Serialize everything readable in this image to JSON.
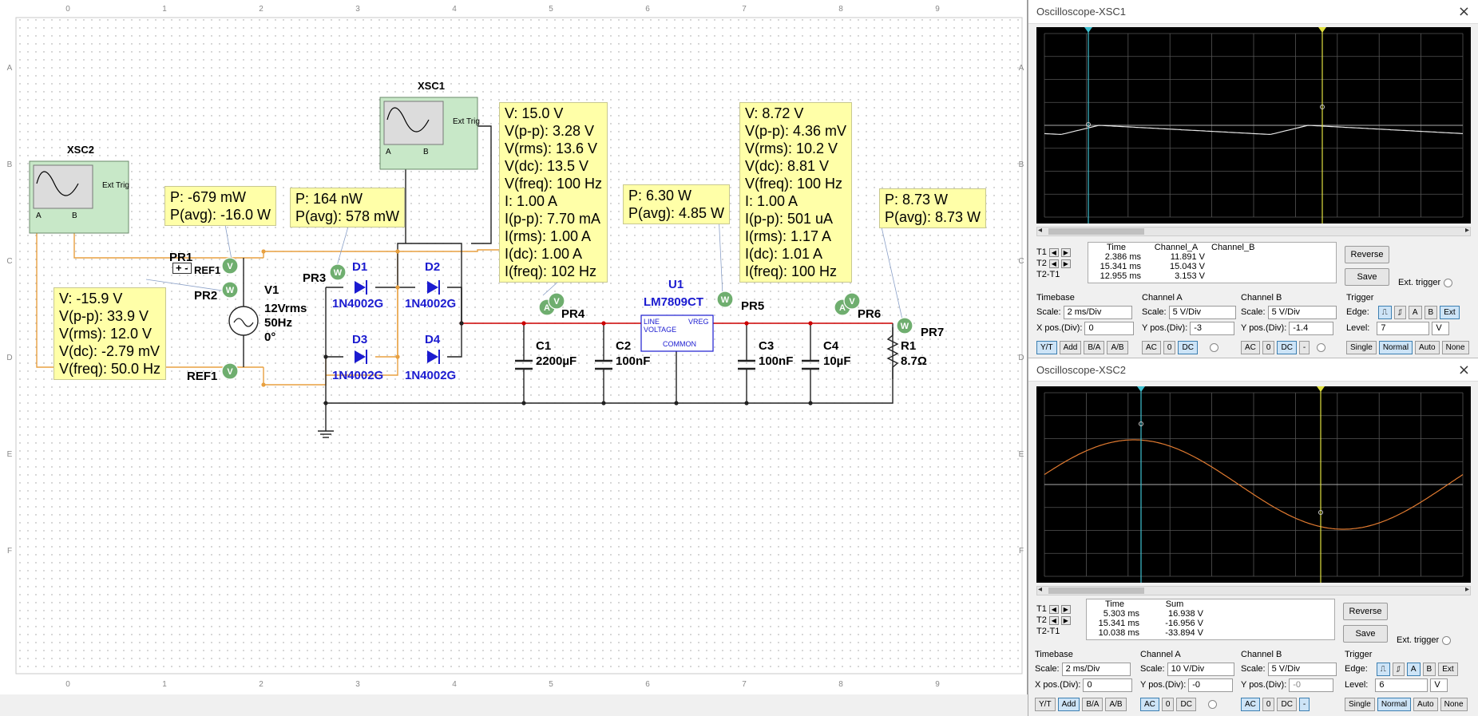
{
  "ruler": {
    "cols": [
      "0",
      "1",
      "2",
      "3",
      "4",
      "5",
      "6",
      "7",
      "8",
      "9"
    ],
    "rows": [
      "A",
      "B",
      "C",
      "D",
      "E",
      "F"
    ]
  },
  "instruments": {
    "xsc1": {
      "name": "XSC1",
      "ext_trig": "Ext Trig",
      "a": "A",
      "b": "B"
    },
    "xsc2": {
      "name": "XSC2",
      "ext_trig": "Ext Trig",
      "a": "A",
      "b": "B"
    }
  },
  "probes": {
    "pr1_box": [
      "P: -679 mW",
      "P(avg): -16.0 W"
    ],
    "pr2_box": [
      "V: -15.9 V",
      "V(p-p): 33.9 V",
      "V(rms): 12.0 V",
      "V(dc): -2.79 mV",
      "V(freq): 50.0 Hz"
    ],
    "pr3_box": [
      "P: 164 nW",
      "P(avg): 578 mW"
    ],
    "pr4_box": [
      "V: 15.0 V",
      "V(p-p): 3.28 V",
      "V(rms): 13.6 V",
      "V(dc): 13.5 V",
      "V(freq): 100 Hz",
      "I: 1.00 A",
      "I(p-p): 7.70 mA",
      "I(rms): 1.00 A",
      "I(dc): 1.00 A",
      "I(freq): 102 Hz"
    ],
    "pr5a_box": [
      "P: 6.30 W",
      "P(avg): 4.85 W"
    ],
    "pr5b_box": [
      "V: 8.72 V",
      "V(p-p): 4.36 mV",
      "V(rms): 10.2 V",
      "V(dc): 8.81 V",
      "V(freq): 100 Hz",
      "I: 1.00 A",
      "I(p-p): 501 uA",
      "I(rms): 1.17 A",
      "I(dc): 1.01 A",
      "I(freq): 100 Hz"
    ],
    "pr7_box": [
      "P: 8.73 W",
      "P(avg): 8.73 W"
    ]
  },
  "labels": {
    "pr1": "PR1",
    "pr2": "PR2",
    "pr3": "PR3",
    "pr4": "PR4",
    "pr5": "PR5",
    "pr6": "PR6",
    "pr7": "PR7",
    "ref1_top": "REF1",
    "ref1_bottom": "REF1",
    "v1_name": "V1",
    "v1_val1": "12Vrms",
    "v1_val2": "50Hz",
    "v1_val3": "0°",
    "d1": "D1",
    "d2": "D2",
    "d3": "D3",
    "d4": "D4",
    "d1_part": "1N4002G",
    "d2_part": "1N4002G",
    "d3_part": "1N4002G",
    "d4_part": "1N4002G",
    "u1": "U1",
    "u1_part": "LM7809CT",
    "u1_line": "LINE",
    "u1_voltage": "VOLTAGE",
    "u1_vreg": "VREG",
    "u1_common": "COMMON",
    "c1": "C1",
    "c1_val": "2200µF",
    "c2": "C2",
    "c2_val": "100nF",
    "c3": "C3",
    "c3_val": "100nF",
    "c4": "C4",
    "c4_val": "10µF",
    "r1": "R1",
    "r1_val": "8.7Ω",
    "probe_v": "V",
    "probe_w": "W",
    "probe_a": "A"
  },
  "scope1": {
    "title": "Oscilloscope-XSC1",
    "readout_headers": [
      "Time",
      "Channel_A",
      "Channel_B"
    ],
    "rows": [
      {
        "label": "T1",
        "time": "2.386 ms",
        "a": "11.891 V",
        "b": ""
      },
      {
        "label": "T2",
        "time": "15.341 ms",
        "a": "15.043 V",
        "b": ""
      },
      {
        "label": "T2-T1",
        "time": "12.955 ms",
        "a": "3.153 V",
        "b": ""
      }
    ],
    "reverse": "Reverse",
    "save": "Save",
    "ext_trigger": "Ext. trigger",
    "timebase": {
      "header": "Timebase",
      "scale_lbl": "Scale:",
      "scale": "2 ms/Div",
      "xpos_lbl": "X pos.(Div):",
      "xpos": "0",
      "modes": [
        "Y/T",
        "Add",
        "B/A",
        "A/B"
      ]
    },
    "channel_a": {
      "header": "Channel A",
      "scale_lbl": "Scale:",
      "scale": "5  V/Div",
      "ypos_lbl": "Y pos.(Div):",
      "ypos": "-3",
      "coupling": [
        "AC",
        "0",
        "DC"
      ]
    },
    "channel_b": {
      "header": "Channel B",
      "scale_lbl": "Scale:",
      "scale": "5  V/Div",
      "ypos_lbl": "Y pos.(Div):",
      "ypos": "-1.4",
      "coupling": [
        "AC",
        "0",
        "DC",
        "-"
      ]
    },
    "trigger": {
      "header": "Trigger",
      "edge_lbl": "Edge:",
      "edge": [
        "A",
        "B",
        "Ext"
      ],
      "level_lbl": "Level:",
      "level": "7",
      "level_unit": "V",
      "modes": [
        "Single",
        "Normal",
        "Auto",
        "None"
      ]
    }
  },
  "scope2": {
    "title": "Oscilloscope-XSC2",
    "readout_headers": [
      "Time",
      "Sum"
    ],
    "rows": [
      {
        "label": "T1",
        "time": "5.303 ms",
        "a": "16.938 V"
      },
      {
        "label": "T2",
        "time": "15.341 ms",
        "a": "-16.956 V"
      },
      {
        "label": "T2-T1",
        "time": "10.038 ms",
        "a": "-33.894 V"
      }
    ],
    "reverse": "Reverse",
    "save": "Save",
    "ext_trigger": "Ext. trigger",
    "timebase": {
      "header": "Timebase",
      "scale_lbl": "Scale:",
      "scale": "2 ms/Div",
      "xpos_lbl": "X pos.(Div):",
      "xpos": "0",
      "modes": [
        "Y/T",
        "Add",
        "B/A",
        "A/B"
      ]
    },
    "channel_a": {
      "header": "Channel A",
      "scale_lbl": "Scale:",
      "scale": "10  V/Div",
      "ypos_lbl": "Y pos.(Div):",
      "ypos": "-0",
      "coupling": [
        "AC",
        "0",
        "DC"
      ]
    },
    "channel_b": {
      "header": "Channel B",
      "scale_lbl": "Scale:",
      "scale": "5  V/Div",
      "ypos_lbl": "Y pos.(Div):",
      "ypos": "-0",
      "coupling": [
        "AC",
        "0",
        "DC",
        "-"
      ]
    },
    "trigger": {
      "header": "Trigger",
      "edge_lbl": "Edge:",
      "edge": [
        "A",
        "B",
        "Ext"
      ],
      "level_lbl": "Level:",
      "level": "6",
      "level_unit": "V",
      "modes": [
        "Single",
        "Normal",
        "Auto",
        "None"
      ]
    }
  },
  "colors": {
    "wire_red": "#cc0000",
    "wire_orange": "#e8a040",
    "wire_black": "#222222",
    "trace_white": "#e6e6e6",
    "trace_orange": "#e07a30",
    "cursor_cyan": "#3fc0d0",
    "cursor_yellow": "#e0e040",
    "probe_bg": "#ffffa8"
  }
}
